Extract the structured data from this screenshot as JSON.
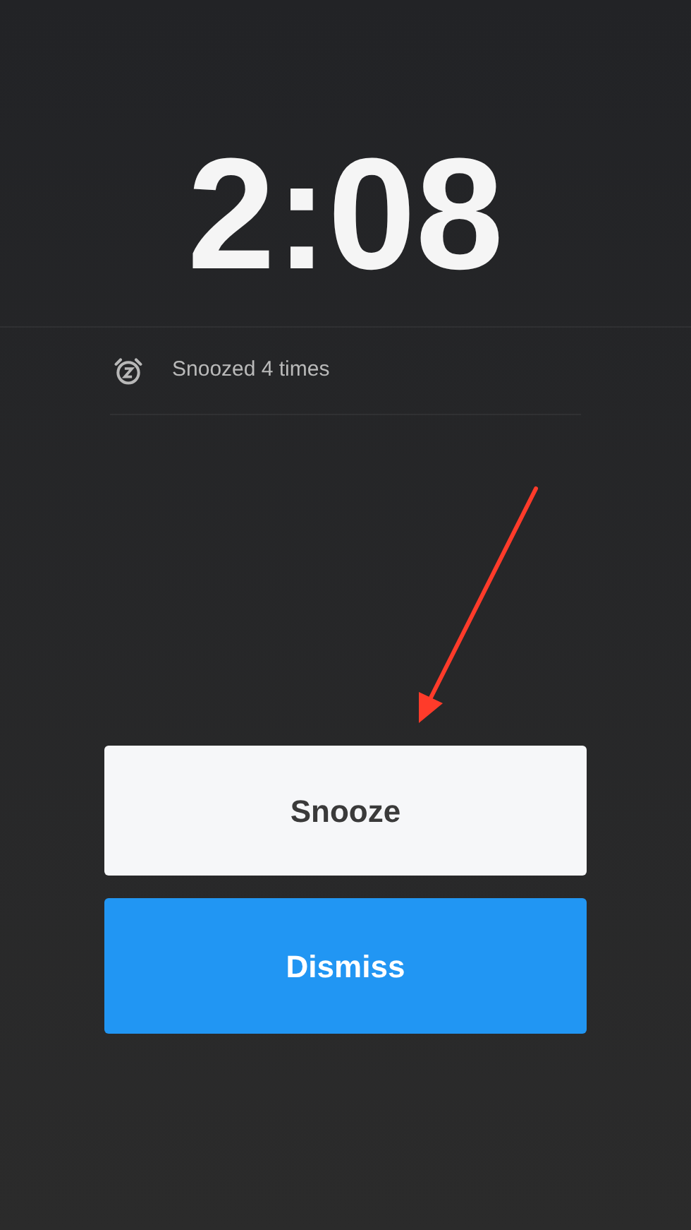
{
  "time": "2:08",
  "snooze_info": {
    "text": "Snoozed 4 times"
  },
  "buttons": [
    {
      "label": "Snooze",
      "kind": "secondary"
    },
    {
      "label": "Dismiss",
      "kind": "primary"
    }
  ]
}
